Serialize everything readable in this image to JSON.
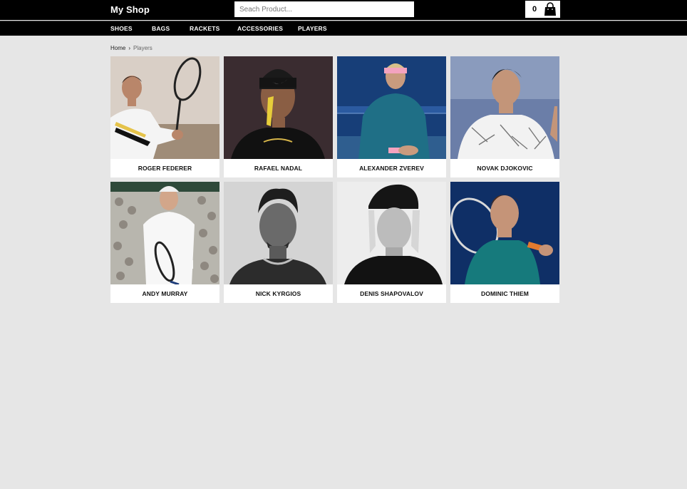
{
  "header": {
    "logo": "My Shop",
    "search_placeholder": "Seach Product...",
    "cart_count": "0"
  },
  "nav": {
    "items": [
      {
        "label": "SHOES"
      },
      {
        "label": "BAGS"
      },
      {
        "label": "RACKETS"
      },
      {
        "label": "ACCESSORIES"
      },
      {
        "label": "PLAYERS"
      }
    ]
  },
  "breadcrumb": {
    "home": "Home",
    "separator": "›",
    "current": "Players"
  },
  "players": [
    {
      "name": "ROGER FEDERER"
    },
    {
      "name": "RAFAEL NADAL"
    },
    {
      "name": "ALEXANDER ZVEREV"
    },
    {
      "name": "NOVAK DJOKOVIC"
    },
    {
      "name": "ANDY MURRAY"
    },
    {
      "name": "NICK KYRGIOS"
    },
    {
      "name": "DENIS SHAPOVALOV"
    },
    {
      "name": "DOMINIC THIEM"
    }
  ],
  "colors": {
    "header_bg": "#000000",
    "page_bg": "#e6e6e6",
    "card_bg": "#ffffff"
  }
}
